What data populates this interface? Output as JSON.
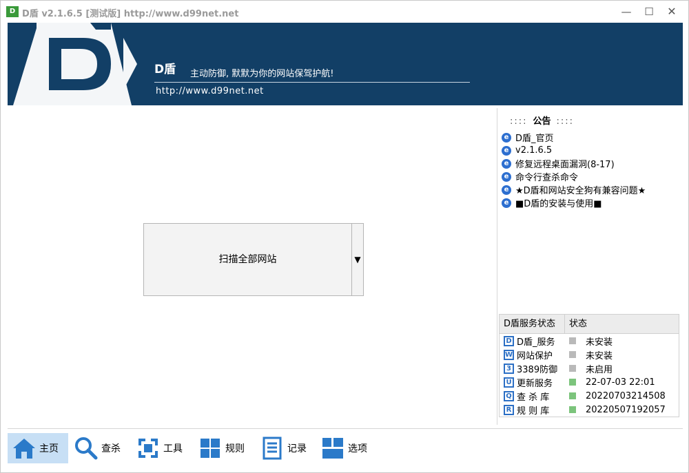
{
  "window": {
    "title": "D盾 v2.1.6.5 [测试版] http://www.d99net.net",
    "icon_text": "D",
    "controls": {
      "minimize": "—",
      "maximize": "☐",
      "close": "✕"
    }
  },
  "banner": {
    "brand": "D盾",
    "slogan": "主动防御, 默默为你的网站保驾护航!",
    "url": "http://www.d99net.net"
  },
  "main": {
    "scan_button_label": "扫描全部网站",
    "scan_dropdown_arrow": "▼"
  },
  "notice": {
    "dots": "::::",
    "title": "公告",
    "items": [
      "D盾_官页",
      "v2.1.6.5",
      "修复远程桌面漏洞(8-17)",
      "命令行查杀命令",
      "★D盾和网站安全狗有兼容问题★",
      "■D盾的安装与使用■"
    ]
  },
  "services": {
    "col_name": "D盾服务状态",
    "col_status": "状态",
    "rows": [
      {
        "name": "D盾_服务",
        "icon": "D",
        "status": "未安装",
        "state": "off"
      },
      {
        "name": "网站保护",
        "icon": "W",
        "status": "未安装",
        "state": "off"
      },
      {
        "name": "3389防御",
        "icon": "3",
        "status": "未启用",
        "state": "off"
      },
      {
        "name": "更新服务",
        "icon": "U",
        "status": "22-07-03 22:01",
        "state": "on"
      },
      {
        "name": "查 杀 库",
        "icon": "Q",
        "status": "20220703214508",
        "state": "on"
      },
      {
        "name": "规 则 库",
        "icon": "R",
        "status": "20220507192057",
        "state": "on"
      }
    ]
  },
  "toolbar": {
    "home": "主页",
    "scan": "查杀",
    "tools": "工具",
    "rules": "规则",
    "log": "记录",
    "options": "选项"
  },
  "colors": {
    "banner_bg": "#123f66",
    "icon_blue": "#2b7ac9",
    "active_tab": "#c7dff5",
    "status_on": "#7cc47c",
    "status_off": "#b9b9b9"
  }
}
